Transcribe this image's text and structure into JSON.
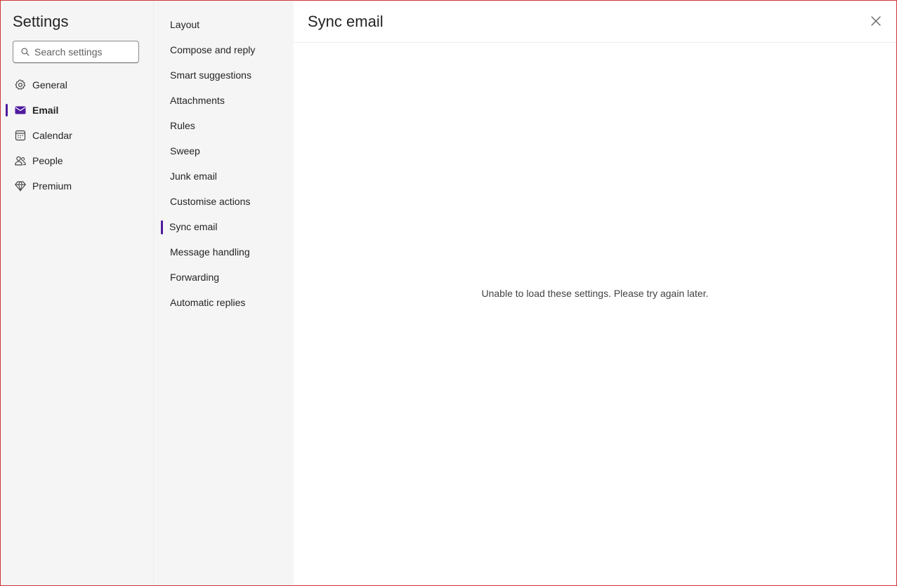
{
  "nav": {
    "title": "Settings",
    "search": {
      "placeholder": "Search settings",
      "icon": "search-icon"
    },
    "items": [
      {
        "label": "General",
        "icon": "gear-icon",
        "active": false
      },
      {
        "label": "Email",
        "icon": "mail-icon",
        "active": true
      },
      {
        "label": "Calendar",
        "icon": "calendar-icon",
        "active": false
      },
      {
        "label": "People",
        "icon": "people-icon",
        "active": false
      },
      {
        "label": "Premium",
        "icon": "diamond-icon",
        "active": false
      }
    ]
  },
  "subnav": {
    "items": [
      {
        "label": "Layout",
        "active": false
      },
      {
        "label": "Compose and reply",
        "active": false
      },
      {
        "label": "Smart suggestions",
        "active": false
      },
      {
        "label": "Attachments",
        "active": false
      },
      {
        "label": "Rules",
        "active": false
      },
      {
        "label": "Sweep",
        "active": false
      },
      {
        "label": "Junk email",
        "active": false
      },
      {
        "label": "Customise actions",
        "active": false
      },
      {
        "label": "Sync email",
        "active": true
      },
      {
        "label": "Message handling",
        "active": false
      },
      {
        "label": "Forwarding",
        "active": false
      },
      {
        "label": "Automatic replies",
        "active": false
      }
    ]
  },
  "content": {
    "title": "Sync email",
    "message": "Unable to load these settings. Please try again later.",
    "close_icon": "close-icon"
  },
  "colors": {
    "accent": "#4f1a9e",
    "frame_border": "#d13438",
    "nav_background": "#f5f5f5"
  }
}
